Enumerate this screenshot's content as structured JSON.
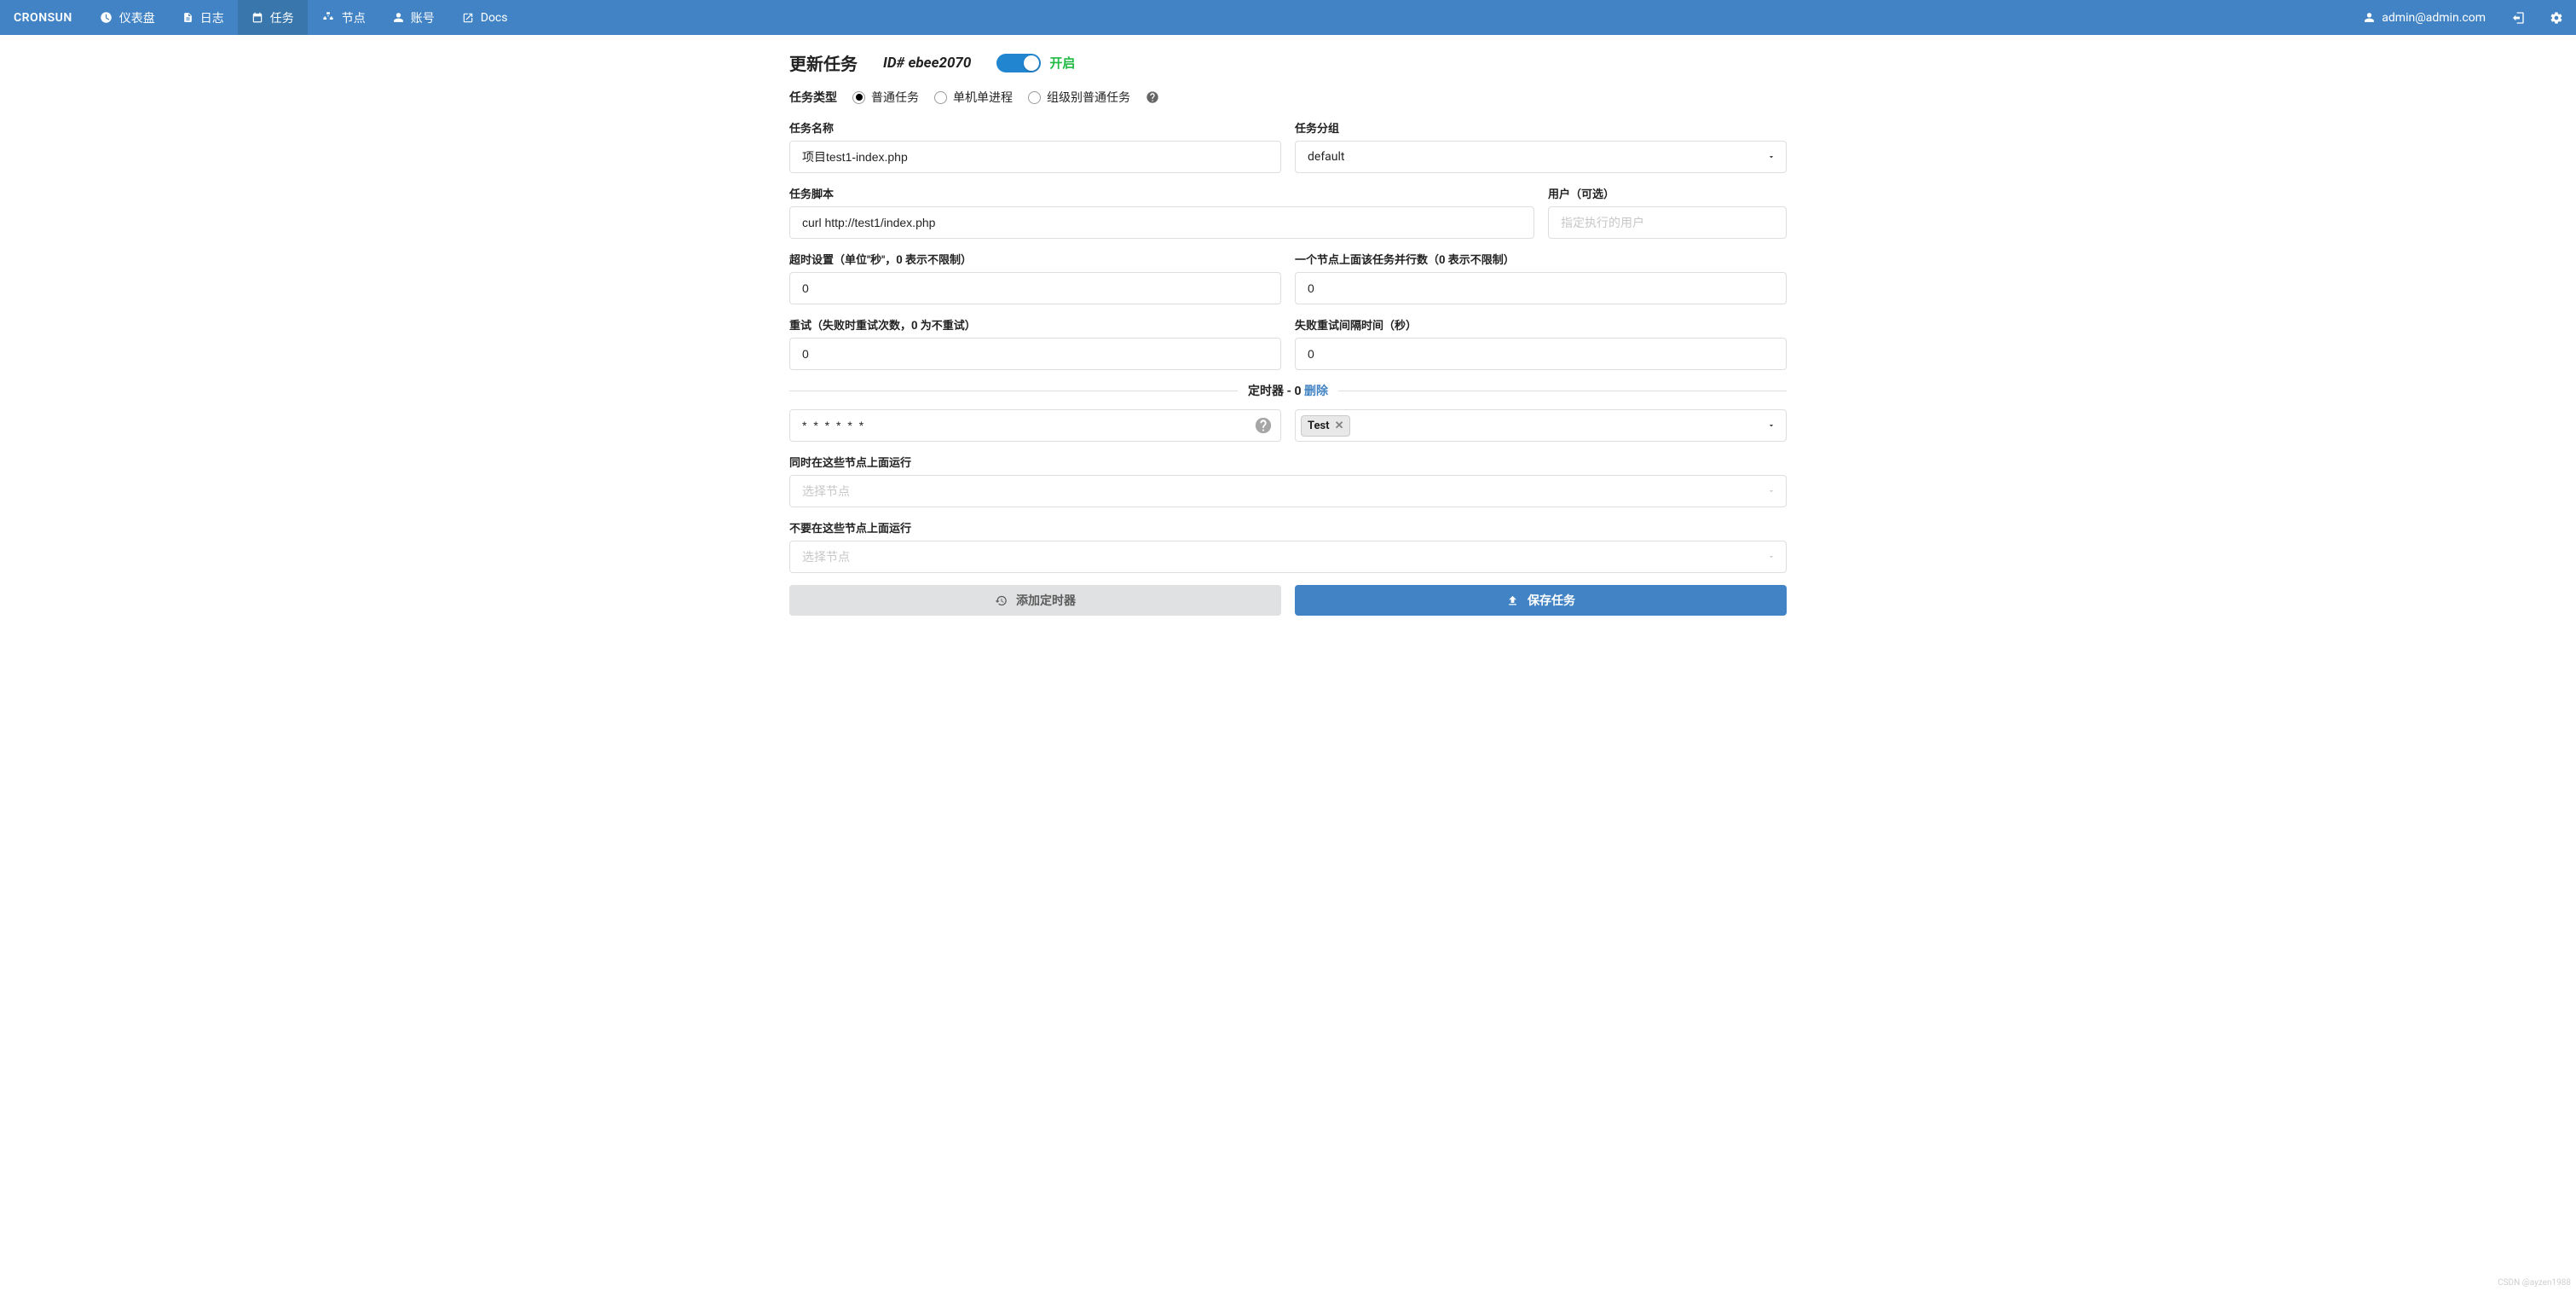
{
  "brand": "CRONSUN",
  "nav": {
    "dashboard": "仪表盘",
    "log": "日志",
    "job": "任务",
    "node": "节点",
    "account": "账号",
    "docs": "Docs"
  },
  "user_email": "admin@admin.com",
  "page": {
    "title": "更新任务",
    "id_label": "ID# ebee2070",
    "toggle_state": "开启"
  },
  "task_type": {
    "label": "任务类型",
    "opts": [
      "普通任务",
      "单机单进程",
      "组级别普通任务"
    ]
  },
  "fields": {
    "name_label": "任务名称",
    "name_value": "项目test1-index.php",
    "group_label": "任务分组",
    "group_value": "default",
    "script_label": "任务脚本",
    "script_value": "curl http://test1/index.php",
    "user_label": "用户（可选）",
    "user_placeholder": "指定执行的用户",
    "timeout_label": "超时设置（单位\"秒\"，0 表示不限制）",
    "timeout_value": "0",
    "parallel_label": "一个节点上面该任务并行数（0 表示不限制）",
    "parallel_value": "0",
    "retry_label": "重试（失败时重试次数，0 为不重试）",
    "retry_value": "0",
    "retry_interval_label": "失败重试间隔时间（秒）",
    "retry_interval_value": "0"
  },
  "timer": {
    "divider_prefix": "定时器 - 0",
    "divider_action": "删除",
    "cron_value": "* * * * * *",
    "node_group_tag": "Test",
    "include_label": "同时在这些节点上面运行",
    "include_placeholder": "选择节点",
    "exclude_label": "不要在这些节点上面运行",
    "exclude_placeholder": "选择节点"
  },
  "buttons": {
    "add_timer": "添加定时器",
    "save": "保存任务"
  },
  "watermark": "CSDN @ayzen1988"
}
